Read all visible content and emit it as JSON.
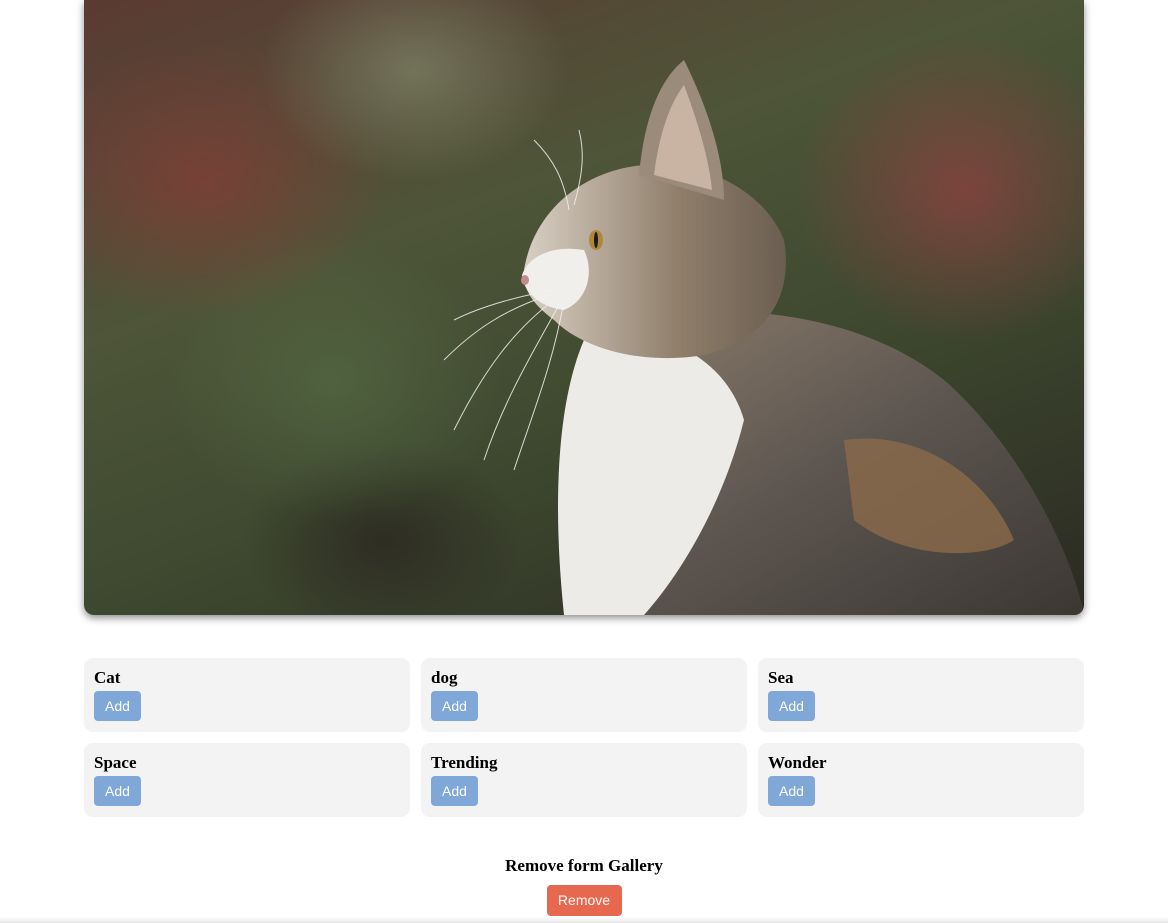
{
  "hero": {
    "image_subject": "cat-photo"
  },
  "categories": [
    {
      "title": "Cat",
      "button": "Add"
    },
    {
      "title": "dog",
      "button": "Add"
    },
    {
      "title": "Sea",
      "button": "Add"
    },
    {
      "title": "Space",
      "button": "Add"
    },
    {
      "title": "Trending",
      "button": "Add"
    },
    {
      "title": "Wonder",
      "button": "Add"
    }
  ],
  "remove": {
    "title": "Remove form Gallery",
    "button": "Remove"
  },
  "colors": {
    "add_button": "#7fa7d8",
    "remove_button": "#e5684f",
    "card_background": "#f3f3f3"
  }
}
